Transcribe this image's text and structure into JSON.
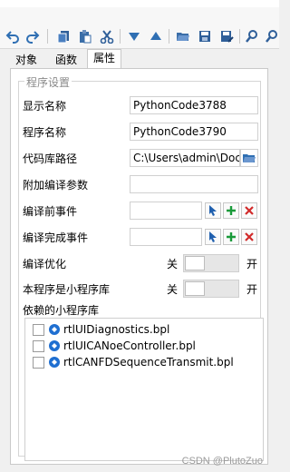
{
  "tabs": [
    {
      "label": "对象"
    },
    {
      "label": "函数"
    },
    {
      "label": "属性"
    }
  ],
  "toolbar": {
    "icons": [
      "undo-icon",
      "redo-icon",
      "copy-icon",
      "paste-icon",
      "cut-icon",
      "move-down-icon",
      "move-up-icon",
      "open-folder-icon",
      "save-icon",
      "save-as-icon",
      "search-icon",
      "search-next-icon"
    ]
  },
  "settings": {
    "group_title": "程序设置",
    "display_name": {
      "label": "显示名称",
      "value": "PythonCode3788"
    },
    "program_name": {
      "label": "程序名称",
      "value": "PythonCode3790"
    },
    "repo_path": {
      "label": "代码库路径",
      "value": "C:\\Users\\admin\\Docur"
    },
    "compile_params": {
      "label": "附加编译参数",
      "value": ""
    },
    "pre_compile_event": {
      "label": "编译前事件"
    },
    "post_compile_event": {
      "label": "编译完成事件"
    },
    "optimize": {
      "label": "编译优化",
      "off": "关",
      "on": "开",
      "state": "off"
    },
    "is_mini": {
      "label": "本程序是小程序库",
      "off": "关",
      "on": "开",
      "state": "off"
    },
    "deps": {
      "label": "依赖的小程序库",
      "items": [
        {
          "name": "rtlUIDiagnostics.bpl",
          "checked": false
        },
        {
          "name": "rtlUICANoeController.bpl",
          "checked": false
        },
        {
          "name": "rtlCANFDSequenceTransmit.bpl",
          "checked": false
        }
      ]
    }
  },
  "watermark": "CSDN @PlutoZuo"
}
